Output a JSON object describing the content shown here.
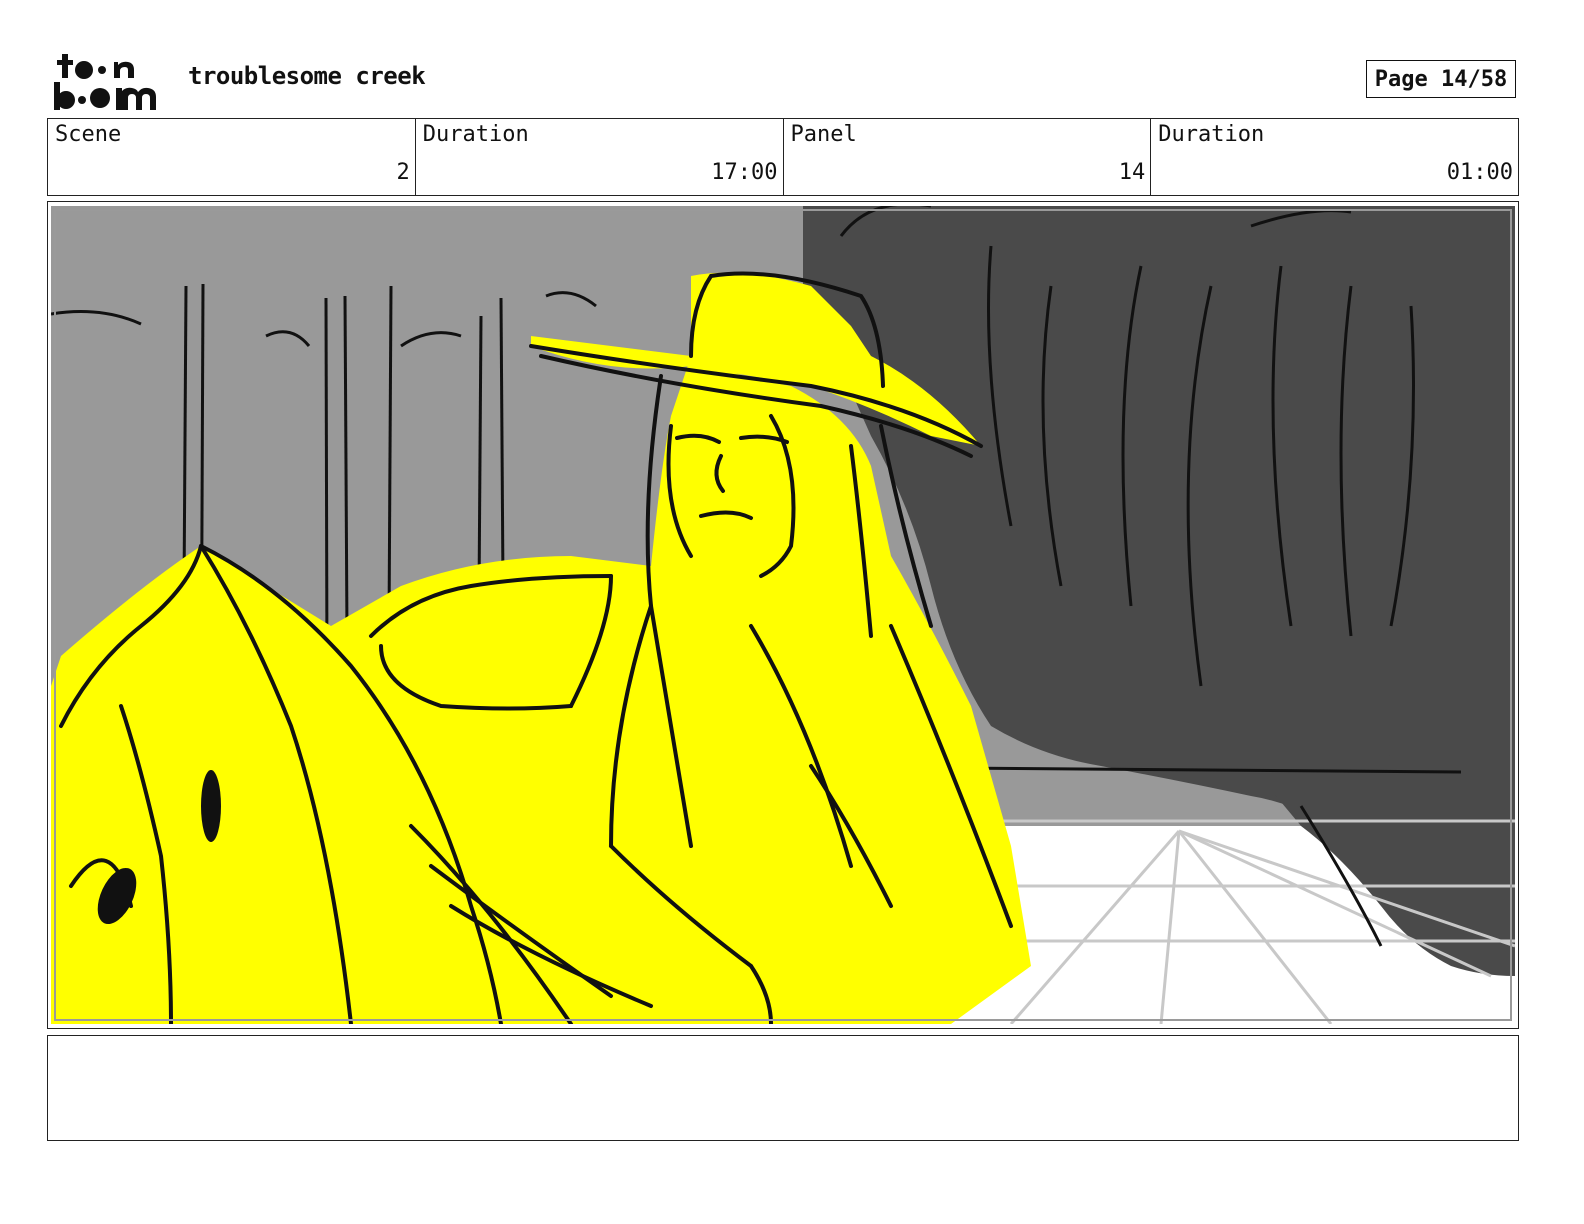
{
  "header": {
    "logo": {
      "icon": "toonboom-logo",
      "text": "toon boom"
    },
    "project_title": "troublesome creek",
    "page_label": "Page 14/58"
  },
  "info": {
    "scene_label": "Scene",
    "scene_value": "2",
    "scene_duration_label": "Duration",
    "scene_duration_value": "17:00",
    "panel_label": "Panel",
    "panel_value": "14",
    "panel_duration_label": "Duration",
    "panel_duration_value": "01:00"
  },
  "panel": {
    "colors": {
      "background_light": "#999999",
      "background_dark": "#4a4a4a",
      "highlight": "#ffff00",
      "floor": "#ffffff",
      "line": "#111111",
      "grid": "#c8c8c8"
    }
  },
  "notes": {
    "text": ""
  }
}
